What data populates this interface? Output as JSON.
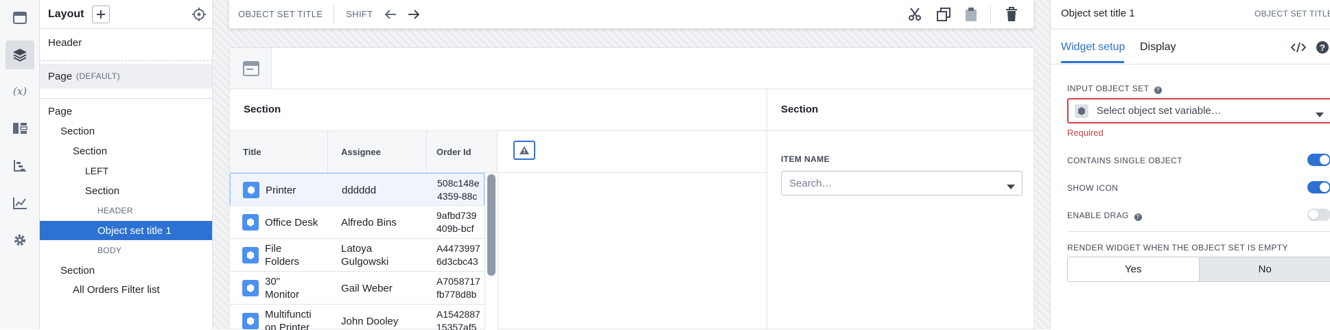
{
  "layout_panel": {
    "title": "Layout",
    "tree": [
      {
        "label": "Header",
        "tag": ""
      },
      {
        "label": "Page",
        "tag": "(DEFAULT)"
      },
      {
        "label": "Page"
      },
      {
        "label": "Section"
      },
      {
        "label": "Section"
      },
      {
        "label": "LEFT"
      },
      {
        "label": "Section"
      },
      {
        "label": "HEADER"
      },
      {
        "label": "Object set title 1"
      },
      {
        "label": "BODY"
      },
      {
        "label": "Section"
      },
      {
        "label": "All Orders Filter list"
      }
    ]
  },
  "toolbar": {
    "widget_label": "OBJECT SET TITLE",
    "shift_label": "SHIFT"
  },
  "canvas": {
    "left_section_title": "Section",
    "right_section_title": "Section",
    "table": {
      "columns": [
        "Title",
        "Assignee",
        "Order Id"
      ],
      "rows": [
        {
          "title": "Printer",
          "assignee": "dddddd",
          "order_id": "508c148e\n4359-88c"
        },
        {
          "title": "Office Desk",
          "assignee": "Alfredo Bins",
          "order_id": "9afbd739\n409b-bcf"
        },
        {
          "title": "File\nFolders",
          "assignee": "Latoya\nGulgowski",
          "order_id": "A4473997\n6d3cbc43"
        },
        {
          "title": "30\"\nMonitor",
          "assignee": "Gail Weber",
          "order_id": "A7058717\nfb778d8b"
        },
        {
          "title": "Multifuncti\non Printer",
          "assignee": "John Dooley",
          "order_id": "A1542887\n15357af5"
        }
      ]
    },
    "filter": {
      "label": "ITEM NAME",
      "placeholder": "Search…"
    }
  },
  "right_panel": {
    "title": "Object set title 1",
    "type_label": "OBJECT SET TITLE",
    "tabs": [
      "Widget setup",
      "Display"
    ],
    "input_object_set_label": "INPUT OBJECT SET",
    "input_object_set_placeholder": "Select object set variable…",
    "required_text": "Required",
    "contains_single_label": "CONTAINS SINGLE OBJECT",
    "contains_single_on": true,
    "show_icon_label": "SHOW ICON",
    "show_icon_on": true,
    "enable_drag_label": "ENABLE DRAG",
    "enable_drag_on": false,
    "render_empty_label": "RENDER WIDGET WHEN THE OBJECT SET IS EMPTY",
    "yes_label": "Yes",
    "no_label": "No",
    "selected_option": "No"
  },
  "colors": {
    "accent": "#2d72d2",
    "error": "#cd4246",
    "object_icon": "#4c90f0"
  }
}
